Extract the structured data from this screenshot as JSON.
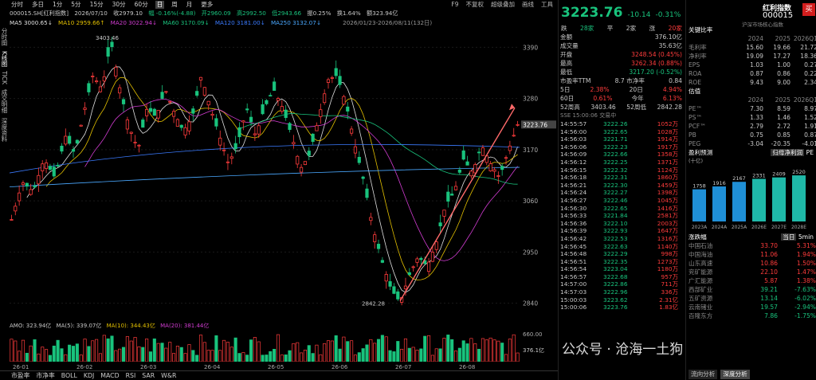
{
  "toolbar": {
    "items": [
      "分时",
      "多日",
      "1分",
      "5分",
      "15分",
      "30分",
      "60分",
      "日",
      "周",
      "月",
      "更多"
    ],
    "active": "日",
    "right": [
      "F9",
      "不复权",
      "超级叠加",
      "画线",
      "工具"
    ]
  },
  "info": {
    "code": "000015.SH[红利指数]",
    "date": "2026/07/10",
    "close": "收2979.10",
    "change": "幅 -0.16%(-4.88)",
    "open": "开2960.09",
    "high": "高2992.50",
    "low": "低2943.66",
    "swing": "振0.25%",
    "turnover": "换1.64%",
    "amount": "额323.94亿"
  },
  "ma": {
    "ma5": "MA5 3000.65↓",
    "ma10": "MA10 2959.66↑",
    "ma20": "MA20 3022.94↓",
    "ma60": "MA60 3170.09↓",
    "ma120": "MA120 3181.00↓",
    "ma250": "MA250 3132.07↓",
    "range": "2026/01/23-2026/08/11(132日)"
  },
  "side": [
    "分时图",
    "K线图",
    "TICK",
    "成交明细",
    "深度资料"
  ],
  "chart": {
    "yTicks": [
      "3390",
      "3280",
      "3170",
      "3060",
      "2950",
      "2840"
    ],
    "xTicks": [
      "26-01",
      "26-02",
      "26-03",
      "26-04",
      "26-05",
      "26-06",
      "26-07",
      "26-08"
    ],
    "highLabel": "3403.46",
    "lowLabel": "2842.28",
    "last": "3223.76",
    "amo": "AMO: 323.94亿",
    "amo5": "MA(5): 339.07亿",
    "amo10": "MA(10): 344.43亿",
    "amo20": "MA(20): 381.44亿",
    "volTop": "660.00",
    "volMid": "376.1亿"
  },
  "bottom": [
    "市盈率",
    "市净率",
    "BOLL",
    "KDJ",
    "MACD",
    "RSI",
    "SAR",
    "W&R"
  ],
  "quote": {
    "price": "3223.76",
    "chg": "-10.14",
    "pct": "-0.31%",
    "up_count": "28家",
    "flat": "平",
    "flat_count": "2家",
    "down": "涨",
    "down_count": "20家",
    "fall_label": "跌"
  },
  "stats": [
    [
      "金额",
      "376.10亿"
    ],
    [
      "成交量",
      "35.63亿"
    ],
    [
      "开盘",
      "3248.54 (0.45%)"
    ],
    [
      "最高",
      "3262.34 (0.88%)"
    ],
    [
      "最低",
      "3217.20 (-0.52%)"
    ],
    [
      "市盈率TTM",
      "8.7  市净率",
      "0.84"
    ]
  ],
  "periods": [
    [
      "5日",
      "2.38%",
      "20日",
      "4.94%"
    ],
    [
      "60日",
      "0.61%",
      "今年",
      "6.13%"
    ],
    [
      "52周高",
      "3403.46",
      "52周低",
      "2842.28"
    ]
  ],
  "time_label": "SSE 15:00:06  交易中",
  "trades": [
    [
      "14:55:57",
      "3222.26",
      "1052万"
    ],
    [
      "14:56:00",
      "3222.65",
      "1028万"
    ],
    [
      "14:56:03",
      "3221.71",
      "1914万"
    ],
    [
      "14:56:06",
      "3222.23",
      "1917万"
    ],
    [
      "14:56:09",
      "3222.66",
      "1358万"
    ],
    [
      "14:56:12",
      "3222.25",
      "1371万"
    ],
    [
      "14:56:15",
      "3222.32",
      "1124万"
    ],
    [
      "14:56:18",
      "3222.31",
      "1860万"
    ],
    [
      "14:56:21",
      "3222.30",
      "1459万"
    ],
    [
      "14:56:24",
      "3222.27",
      "1398万"
    ],
    [
      "14:56:27",
      "3222.46",
      "1045万"
    ],
    [
      "14:56:30",
      "3222.65",
      "1416万"
    ],
    [
      "14:56:33",
      "3221.84",
      "2581万"
    ],
    [
      "14:56:36",
      "3222.10",
      "2003万"
    ],
    [
      "14:56:39",
      "3222.93",
      "1647万"
    ],
    [
      "14:56:42",
      "3222.53",
      "1316万"
    ],
    [
      "14:56:45",
      "3222.63",
      "1140万"
    ],
    [
      "14:56:48",
      "3222.29",
      "998万"
    ],
    [
      "14:56:51",
      "3222.35",
      "1273万"
    ],
    [
      "14:56:54",
      "3223.04",
      "1180万"
    ],
    [
      "14:56:57",
      "3222.68",
      "957万"
    ],
    [
      "14:57:00",
      "3222.86",
      "711万"
    ],
    [
      "14:57:03",
      "3222.96",
      "336万"
    ],
    [
      "15:00:03",
      "3223.62",
      "2.31亿"
    ],
    [
      "15:00:06",
      "3223.76",
      "1.83亿"
    ]
  ],
  "index": {
    "name": "红利指数",
    "code": "000015",
    "buy": "买",
    "sub": "沪深市场核心指数"
  },
  "fin": {
    "title": "关键比率",
    "cols": [
      "2024",
      "2025",
      "2026Q1"
    ],
    "rows": [
      [
        "毛利率",
        "15.60",
        "19.66",
        "21.72"
      ],
      [
        "净利率",
        "19.09",
        "17.27",
        "18.36"
      ],
      [
        "EPS",
        "1.03",
        "1.00",
        "0.27"
      ],
      [
        "ROA",
        "0.87",
        "0.86",
        "0.22"
      ],
      [
        "ROE",
        "9.43",
        "9.00",
        "2.34"
      ]
    ]
  },
  "val": {
    "title": "估值",
    "cols": [
      "2024",
      "2025",
      "2026Q1"
    ],
    "rows": [
      [
        "PE™",
        "7.30",
        "8.59",
        "8.97"
      ],
      [
        "PS™",
        "1.33",
        "1.46",
        "1.52"
      ],
      [
        "PCF™",
        "2.79",
        "2.72",
        "1.91"
      ],
      [
        "PB",
        "0.75",
        "0.85",
        "0.87"
      ],
      [
        "PEG",
        "-3.04",
        "-20.35",
        "-4.01"
      ]
    ]
  },
  "profit": {
    "title": "盈利预测",
    "unit": "(十亿)",
    "tabs": [
      "归母净利润",
      "PE"
    ],
    "bars": [
      [
        "2023A",
        "1758"
      ],
      [
        "2024A",
        "1916"
      ],
      [
        "2025A",
        "2167"
      ],
      [
        "2026E",
        "2331"
      ],
      [
        "2027E",
        "2409"
      ],
      [
        "2028E",
        "2520"
      ]
    ]
  },
  "movers": {
    "title": "涨跌幅",
    "tabs": [
      "当日",
      "5min"
    ],
    "rows": [
      [
        "中国石油",
        "33.70",
        "5.31%"
      ],
      [
        "中国海油",
        "11.06",
        "1.94%"
      ],
      [
        "山东高速",
        "10.86",
        "1.50%"
      ],
      [
        "兖矿能源",
        "22.10",
        "1.47%"
      ],
      [
        "广汇能源",
        "5.87",
        "1.38%"
      ],
      [
        "西部矿业",
        "39.21",
        "-7.63%"
      ],
      [
        "五矿资源",
        "13.14",
        "-6.02%"
      ],
      [
        "云南锗业",
        "19.57",
        "-2.94%"
      ],
      [
        "百隆东方",
        "7.86",
        "-1.75%"
      ]
    ]
  },
  "bottom_right": [
    "流向分析",
    "深度分析"
  ],
  "watermark": "公众号 · 沧海一土狗",
  "colors": {
    "up": "#ff3c3c",
    "down": "#19c37d",
    "ma5": "#e0e0e0",
    "ma10": "#e3c000",
    "ma20": "#d23cd2",
    "ma60": "#19c37d",
    "ma120": "#3b7bff",
    "ma250": "#4aa8ff"
  }
}
